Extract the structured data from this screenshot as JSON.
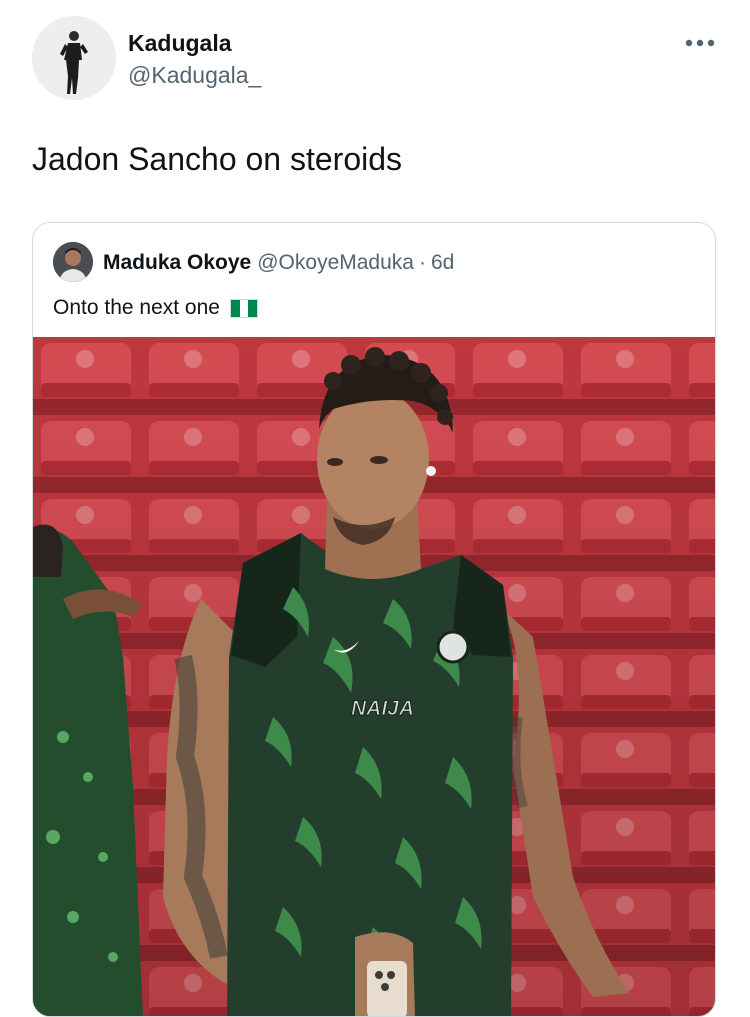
{
  "tweet": {
    "author_name": "Kadugala",
    "author_handle": "@Kadugala_",
    "more_icon": "more-horizontal-icon",
    "text": "Jadon Sancho on steroids"
  },
  "quoted_tweet": {
    "author_name": "Maduka Okoye",
    "author_handle": "@OkoyeMaduka",
    "separator": "·",
    "time_ago": "6d",
    "text": "Onto the next one",
    "emoji": "nigeria-flag",
    "photo_jersey_text": "NAIJA"
  },
  "colors": {
    "primary_text": "#0f1419",
    "secondary_text": "#536471",
    "border": "#cfd9de",
    "stadium_red": "#d8454c",
    "jersey_green": "#2f6a3c",
    "nigeria_green": "#008751"
  }
}
